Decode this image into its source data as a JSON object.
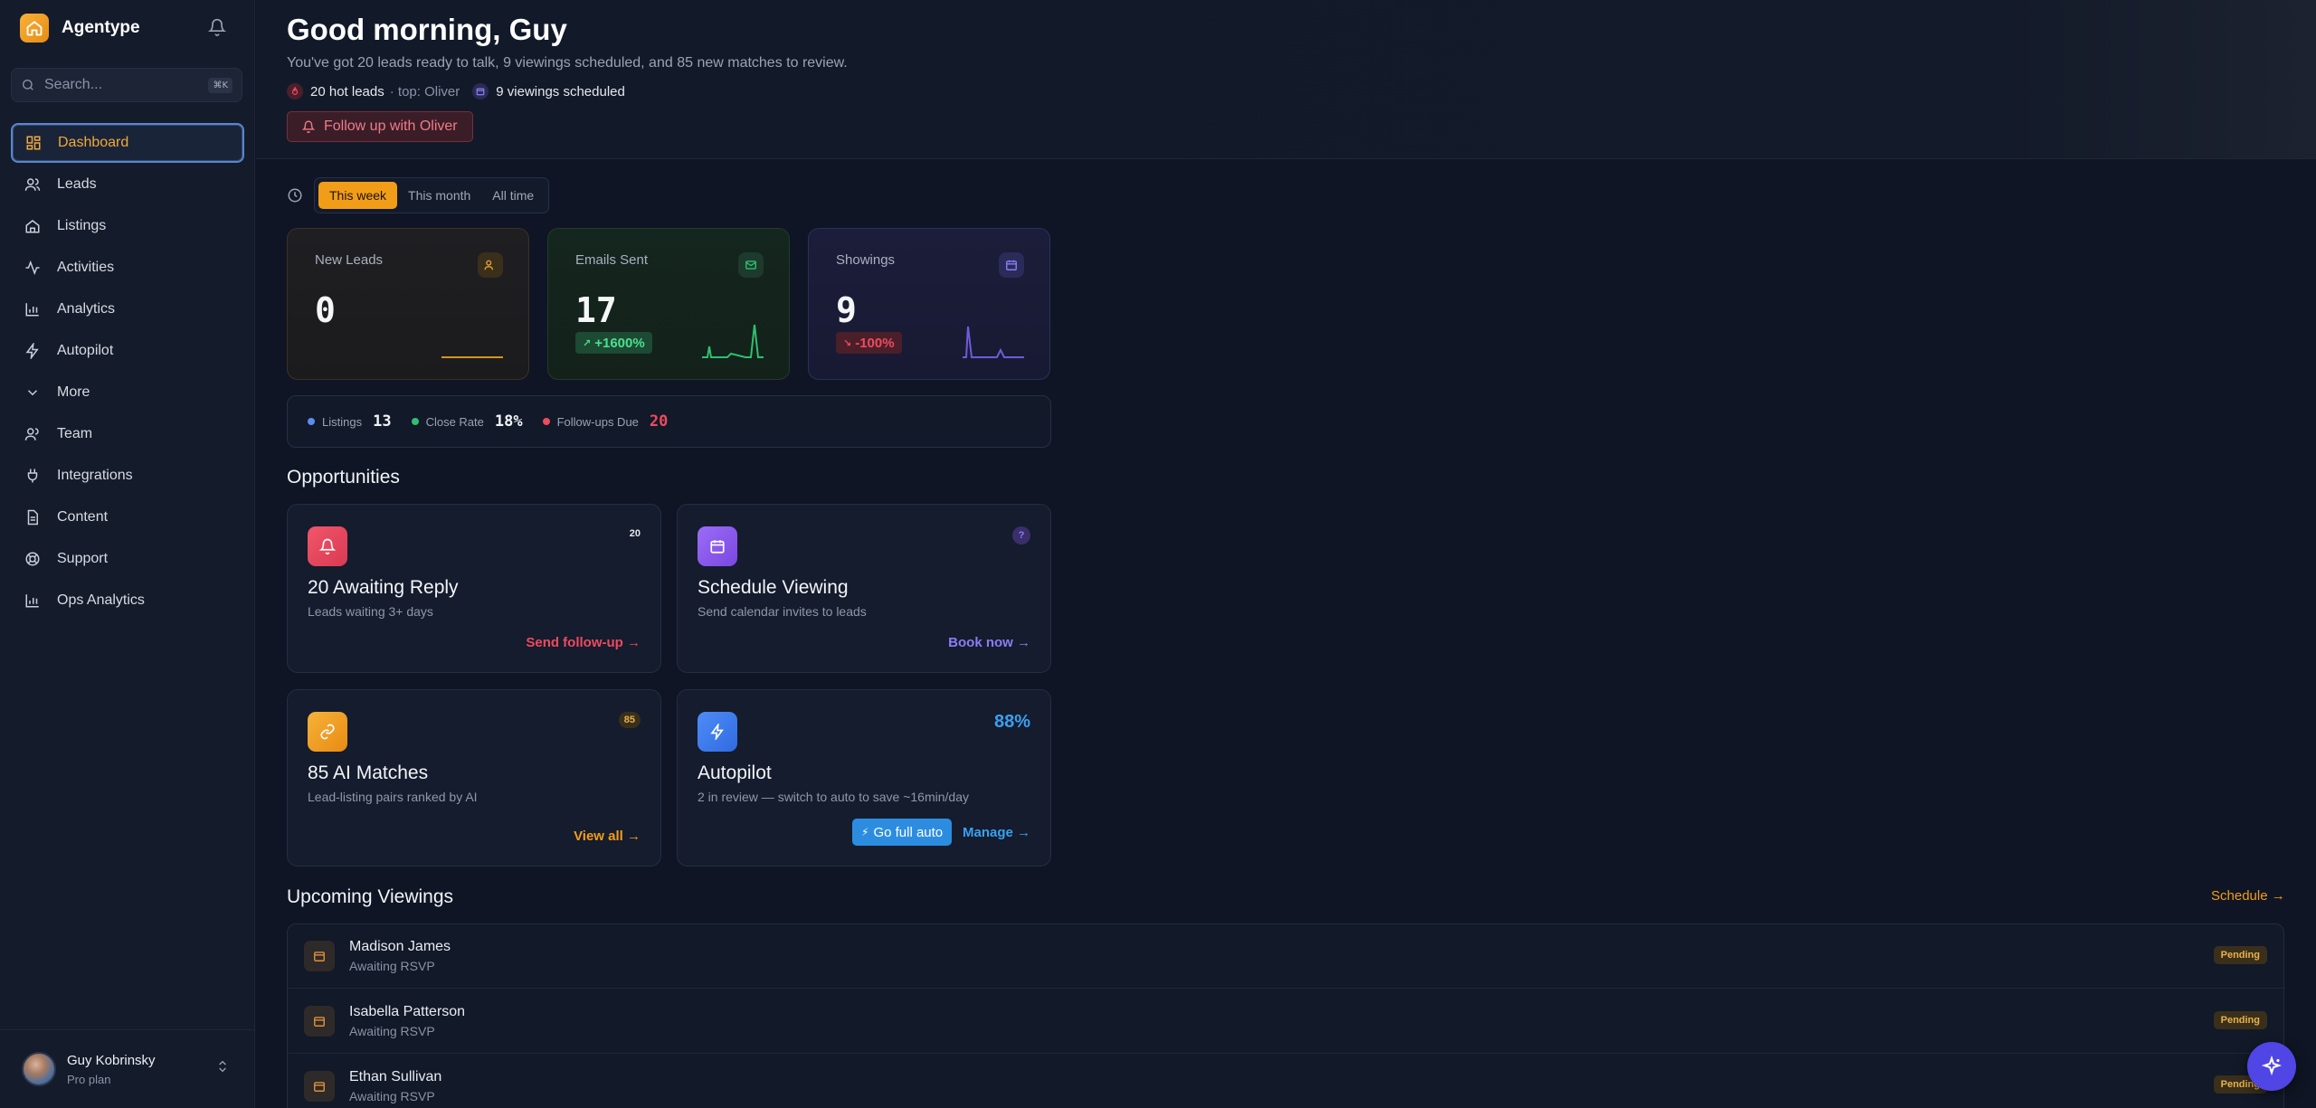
{
  "app": {
    "name": "Agentype"
  },
  "search": {
    "placeholder": "Search...",
    "shortcut": "⌘K"
  },
  "nav": [
    {
      "label": "Dashboard",
      "icon": "dashboard-icon",
      "active": true
    },
    {
      "label": "Leads",
      "icon": "users-icon"
    },
    {
      "label": "Listings",
      "icon": "home-icon"
    },
    {
      "label": "Activities",
      "icon": "activity-icon"
    },
    {
      "label": "Analytics",
      "icon": "bar-chart-icon"
    },
    {
      "label": "Autopilot",
      "icon": "lightning-icon"
    },
    {
      "label": "More",
      "icon": "chevron-down-icon"
    },
    {
      "label": "Team",
      "icon": "users-icon"
    },
    {
      "label": "Integrations",
      "icon": "plug-icon"
    },
    {
      "label": "Content",
      "icon": "document-icon"
    },
    {
      "label": "Support",
      "icon": "lifebuoy-icon"
    },
    {
      "label": "Ops Analytics",
      "icon": "bar-chart-icon"
    }
  ],
  "user": {
    "name": "Guy Kobrinsky",
    "plan": "Pro plan"
  },
  "header": {
    "greeting": "Good morning, Guy",
    "summary": "You've got 20 leads ready to talk, 9 viewings scheduled, and 85 new matches to review.",
    "hot_leads": "20 hot leads",
    "hot_leads_top": "· top: Oliver",
    "viewings": "9 viewings scheduled",
    "follow_button": "Follow up with Oliver"
  },
  "range": {
    "options": [
      "This week",
      "This month",
      "All time"
    ],
    "selected": "This week"
  },
  "kpis": [
    {
      "title": "New Leads",
      "value": "0",
      "badge": "",
      "color": "#d4961e"
    },
    {
      "title": "Emails Sent",
      "value": "17",
      "badge": "+1600%",
      "color": "#2fbf71"
    },
    {
      "title": "Showings",
      "value": "9",
      "badge": "-100%",
      "color": "#6d5bd9"
    }
  ],
  "stats": [
    {
      "label": "Listings",
      "value": "13",
      "color": "#5b8def"
    },
    {
      "label": "Close Rate",
      "value": "18%",
      "color": "#2fbf71"
    },
    {
      "label": "Follow-ups Due",
      "value": "20",
      "color": "#ef4a5e"
    }
  ],
  "opportunities_title": "Opportunities",
  "opportunities": [
    {
      "title": "20 Awaiting Reply",
      "subtitle": "Leads waiting 3+ days",
      "link": "Send follow-up →",
      "count": "20",
      "accent": "#ef4a5e"
    },
    {
      "title": "Schedule Viewing",
      "subtitle": "Send calendar invites to leads",
      "link": "Book now →",
      "count": "?",
      "accent": "#8b5cf6"
    },
    {
      "title": "85 AI Matches",
      "subtitle": "Lead-listing pairs ranked by AI",
      "link": "View all →",
      "count": "85",
      "accent": "#f29d18"
    },
    {
      "title": "Autopilot",
      "subtitle": "2 in review — switch to auto to save ~16min/day",
      "link": "Manage →",
      "percent": "88%",
      "action": "Go full auto",
      "accent": "#3b82f6"
    }
  ],
  "viewings_title": "Upcoming Viewings",
  "viewings_link": "Schedule →",
  "viewings": [
    {
      "name": "Madison James",
      "status": "Awaiting RSVP",
      "badge": "Pending"
    },
    {
      "name": "Isabella Patterson",
      "status": "Awaiting RSVP",
      "badge": "Pending"
    },
    {
      "name": "Ethan Sullivan",
      "status": "Awaiting RSVP",
      "badge": "Pending"
    }
  ]
}
